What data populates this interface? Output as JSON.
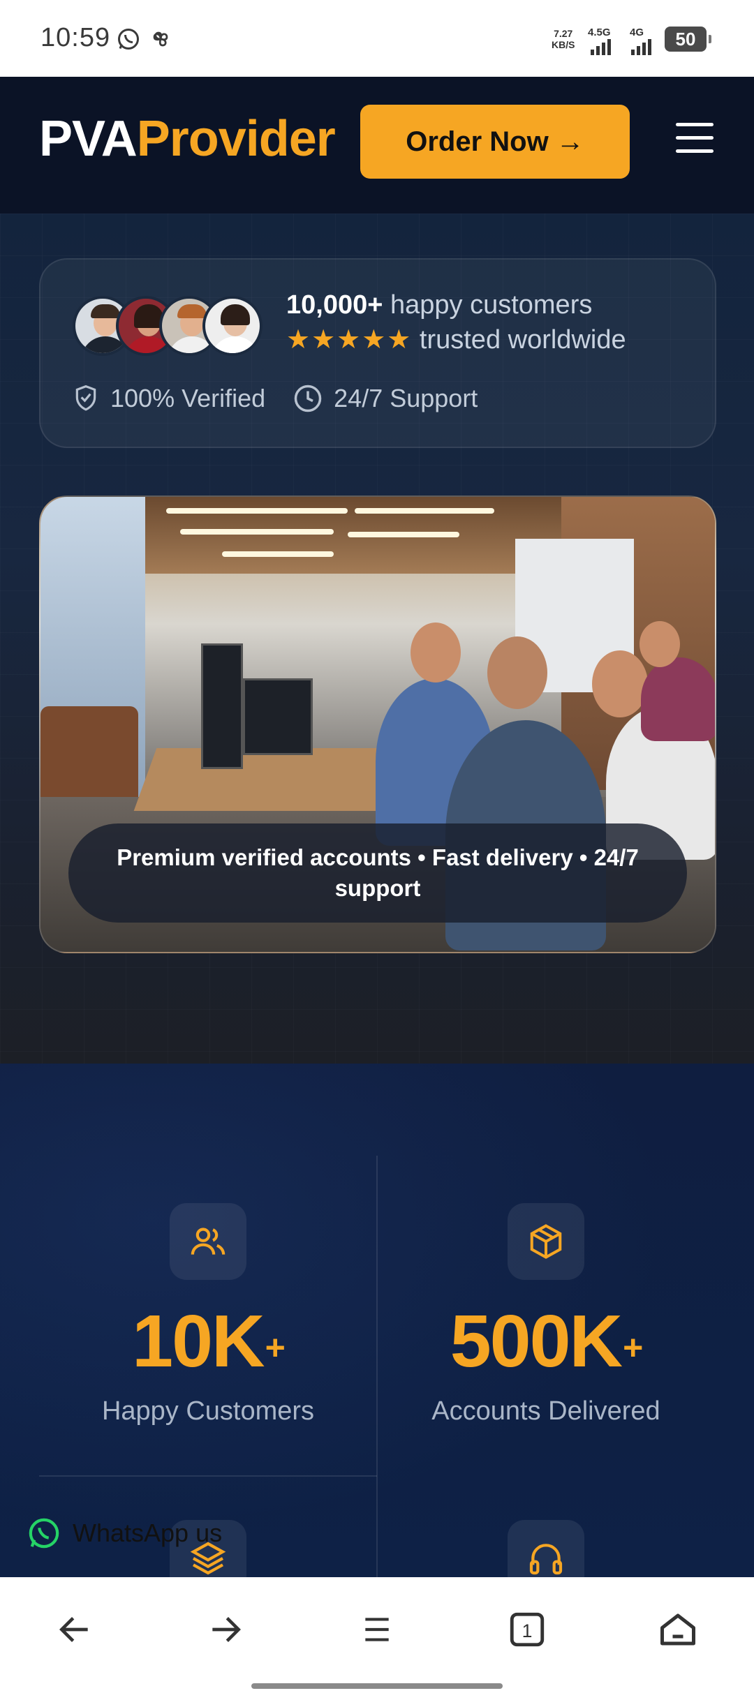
{
  "status_bar": {
    "time": "10:59",
    "speed_value": "7.27",
    "speed_unit": "KB/S",
    "net1": "4.5G",
    "net2": "4G",
    "battery": "50"
  },
  "header": {
    "logo_part1": "PVA",
    "logo_part2": "Provider",
    "order_button": "Order Now →",
    "menu_icon": "hamburger-menu-icon"
  },
  "trust": {
    "customers_count": "10,000+",
    "customers_text": "happy customers",
    "stars": "★★★★★",
    "trusted_text": "trusted worldwide",
    "badge_verified": "100% Verified",
    "badge_support": "24/7 Support"
  },
  "hero_image": {
    "caption": "Premium verified accounts • Fast delivery • 24/7 support"
  },
  "stats": [
    {
      "icon": "users-icon",
      "value": "10K",
      "suffix": "+",
      "label": "Happy Customers"
    },
    {
      "icon": "package-icon",
      "value": "500K",
      "suffix": "+",
      "label": "Accounts Delivered"
    },
    {
      "icon": "layers-icon"
    },
    {
      "icon": "headphones-icon"
    }
  ],
  "whatsapp": {
    "label": "WhatsApp us"
  },
  "colors": {
    "accent": "#f6a623",
    "header_bg": "#0b1326",
    "stats_bg": "#0f2043"
  }
}
